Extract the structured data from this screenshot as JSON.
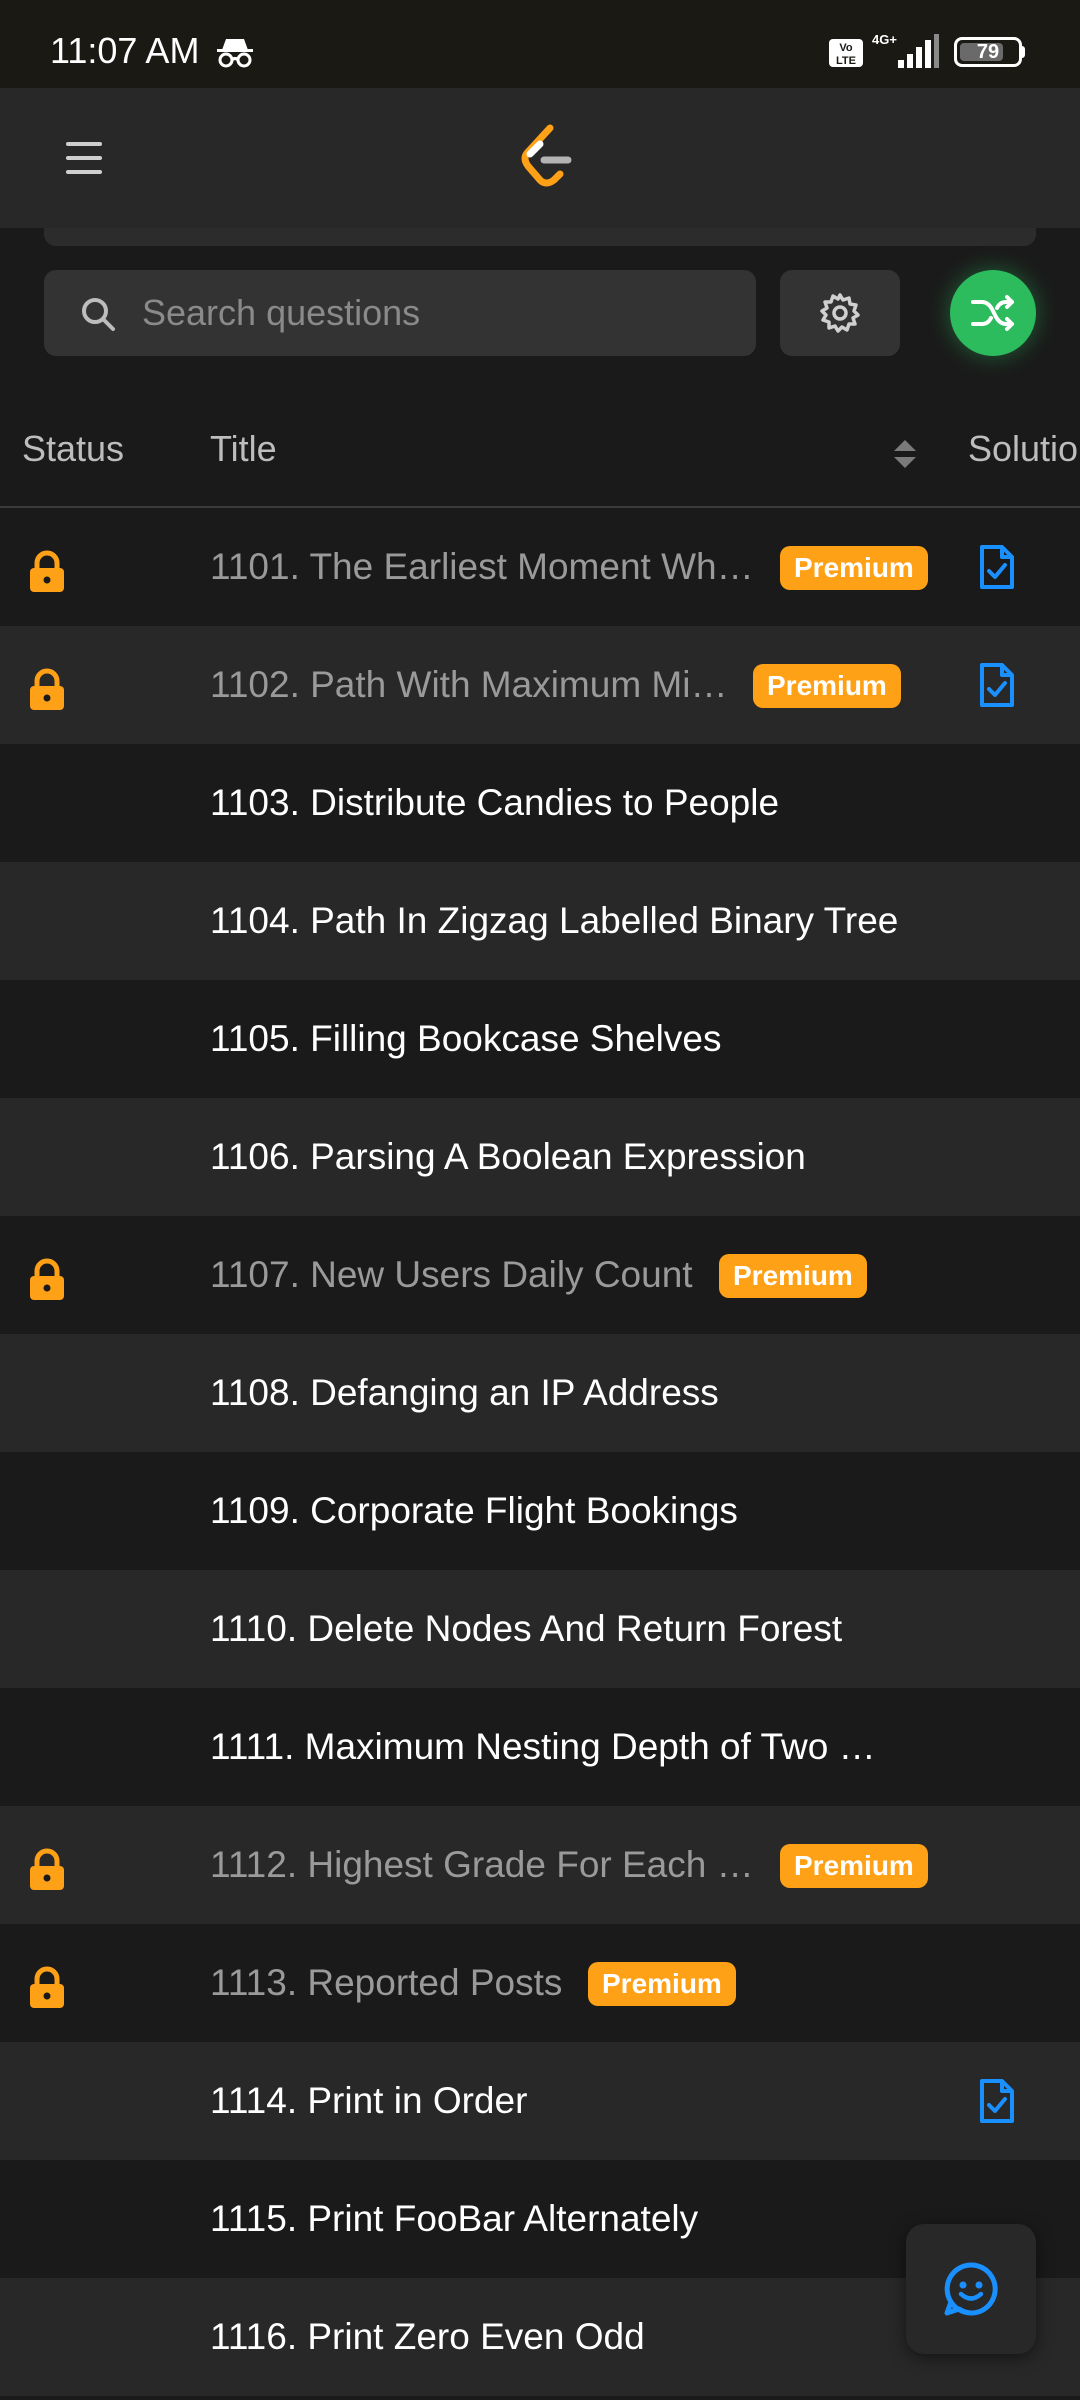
{
  "status_bar": {
    "time": "11:07 AM",
    "network": "4G+",
    "volte": "Vo LTE",
    "battery": "79"
  },
  "search": {
    "placeholder": "Search questions"
  },
  "table": {
    "headers": {
      "status": "Status",
      "title": "Title",
      "solution": "Solution"
    },
    "rows": [
      {
        "title": "1101. The Earliest Moment Wh…",
        "locked": true,
        "premium": true,
        "solution": true
      },
      {
        "title": "1102. Path With Maximum Mi…",
        "locked": true,
        "premium": true,
        "solution": true
      },
      {
        "title": "1103. Distribute Candies to People",
        "locked": false,
        "premium": false,
        "solution": false
      },
      {
        "title": "1104. Path In Zigzag Labelled Binary Tree",
        "locked": false,
        "premium": false,
        "solution": false
      },
      {
        "title": "1105. Filling Bookcase Shelves",
        "locked": false,
        "premium": false,
        "solution": false
      },
      {
        "title": "1106. Parsing A Boolean Expression",
        "locked": false,
        "premium": false,
        "solution": false
      },
      {
        "title": "1107. New Users Daily Count",
        "locked": true,
        "premium": true,
        "solution": false
      },
      {
        "title": "1108. Defanging an IP Address",
        "locked": false,
        "premium": false,
        "solution": false
      },
      {
        "title": "1109. Corporate Flight Bookings",
        "locked": false,
        "premium": false,
        "solution": false
      },
      {
        "title": "1110. Delete Nodes And Return Forest",
        "locked": false,
        "premium": false,
        "solution": false
      },
      {
        "title": "1111. Maximum Nesting Depth of Two …",
        "locked": false,
        "premium": false,
        "solution": false
      },
      {
        "title": "1112. Highest Grade For Each …",
        "locked": true,
        "premium": true,
        "solution": false
      },
      {
        "title": "1113. Reported Posts",
        "locked": true,
        "premium": true,
        "solution": false
      },
      {
        "title": "1114. Print in Order",
        "locked": false,
        "premium": false,
        "solution": true
      },
      {
        "title": "1115. Print FooBar Alternately",
        "locked": false,
        "premium": false,
        "solution": false
      },
      {
        "title": "1116. Print Zero Even Odd",
        "locked": false,
        "premium": false,
        "solution": false
      }
    ],
    "premium_label": "Premium"
  },
  "icons": {
    "menu": "menu-icon",
    "logo": "leetcode-logo-icon",
    "search": "search-icon",
    "settings": "gear-icon",
    "shuffle": "shuffle-icon",
    "sort": "sort-icon",
    "lock": "lock-icon",
    "solution": "solution-document-icon",
    "feedback": "smile-icon"
  },
  "colors": {
    "premium": "#ffa116",
    "accent_green": "#2cbb5d",
    "solution_blue": "#1a90ff",
    "lock": "#ffa116"
  }
}
